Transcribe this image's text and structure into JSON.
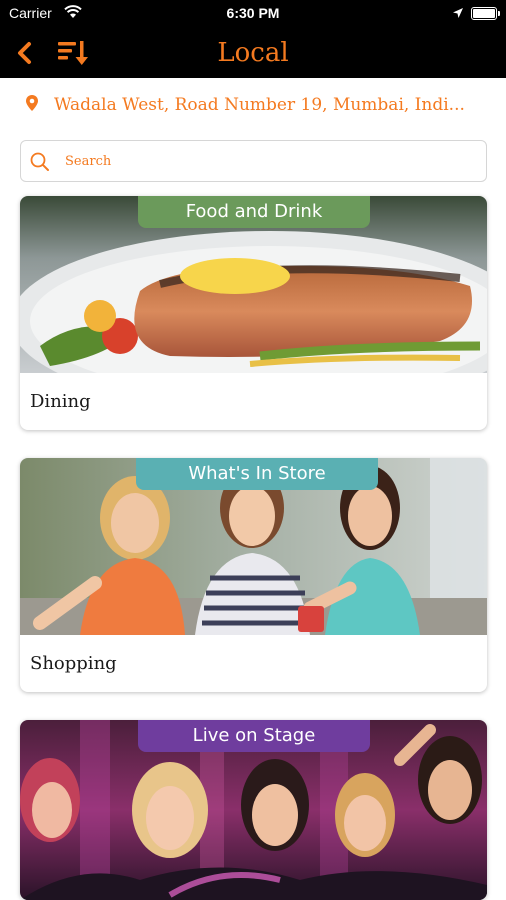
{
  "status_bar": {
    "carrier": "Carrier",
    "time": "6:30 PM",
    "icons": [
      "wifi-icon",
      "location-arrow-icon",
      "battery-icon"
    ]
  },
  "nav": {
    "title": "Local",
    "back_icon": "chevron-left-icon",
    "sort_icon": "sort-icon"
  },
  "location": {
    "icon": "map-pin-icon",
    "text": "Wadala West, Road Number 19, Mumbai, Indi..."
  },
  "search": {
    "icon": "search-icon",
    "placeholder": "Search"
  },
  "cards": [
    {
      "banner": "Food and Drink",
      "label": "Dining",
      "banner_color": "#6b9a5b"
    },
    {
      "banner": "What's In Store",
      "label": "Shopping",
      "banner_color": "#5ab0b3"
    },
    {
      "banner": "Live on Stage",
      "label": "",
      "banner_color": "#6f3d9e"
    }
  ],
  "colors": {
    "accent": "#f47a20",
    "bar_background": "#000000"
  }
}
